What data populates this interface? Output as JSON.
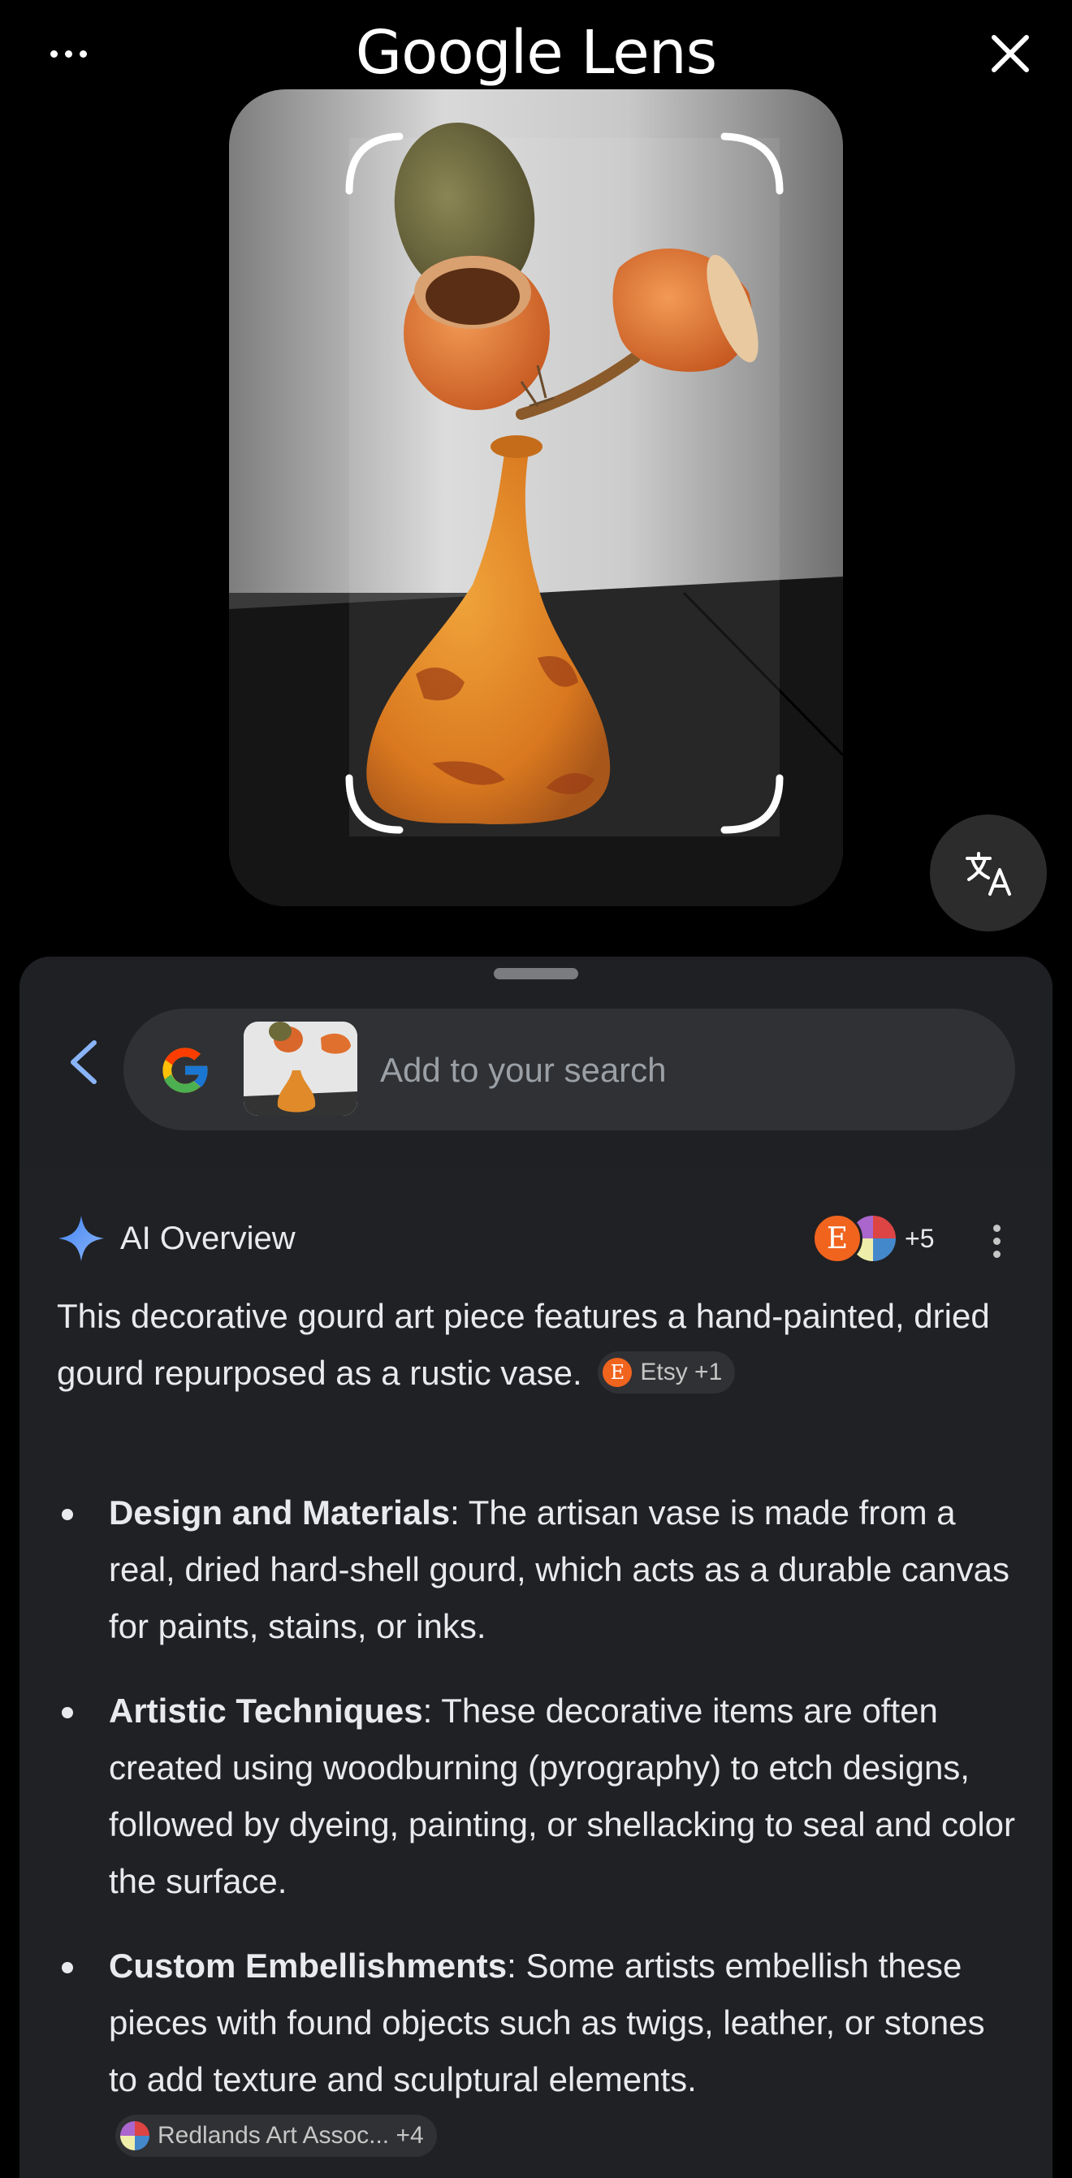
{
  "app": {
    "title": "Google Lens"
  },
  "search": {
    "placeholder": "Add to your search"
  },
  "ai_overview": {
    "title": "AI Overview",
    "source_count": "+5",
    "summary": "This decorative gourd art piece features a hand-painted, dried gourd repurposed as a rustic vase.",
    "summary_chip": "Etsy +1",
    "bullets": [
      {
        "heading": "Design and Materials",
        "text": ": The artisan vase is made from a real, dried hard-shell gourd, which acts as a durable canvas for paints, stains, or inks."
      },
      {
        "heading": "Artistic Techniques",
        "text": ": These decorative items are often created using woodburning (pyrography) to etch designs, followed by dyeing, painting, or shellacking to seal and color the surface."
      },
      {
        "heading": "Custom Embellishments",
        "text": ": Some artists embellish these pieces with found objects such as twigs, leather, or stones to add texture and sculptural elements.",
        "chip": "Redlands Art Assoc... +4"
      }
    ]
  },
  "colors": {
    "accent": "#8ab4f8",
    "sheet_bg": "#202124",
    "etsy": "#f1641e"
  },
  "icons": [
    "more-horiz-icon",
    "close-icon",
    "translate-icon",
    "back-arrow-icon",
    "google-g-icon",
    "ai-sparkle-icon",
    "overflow-menu-icon"
  ]
}
